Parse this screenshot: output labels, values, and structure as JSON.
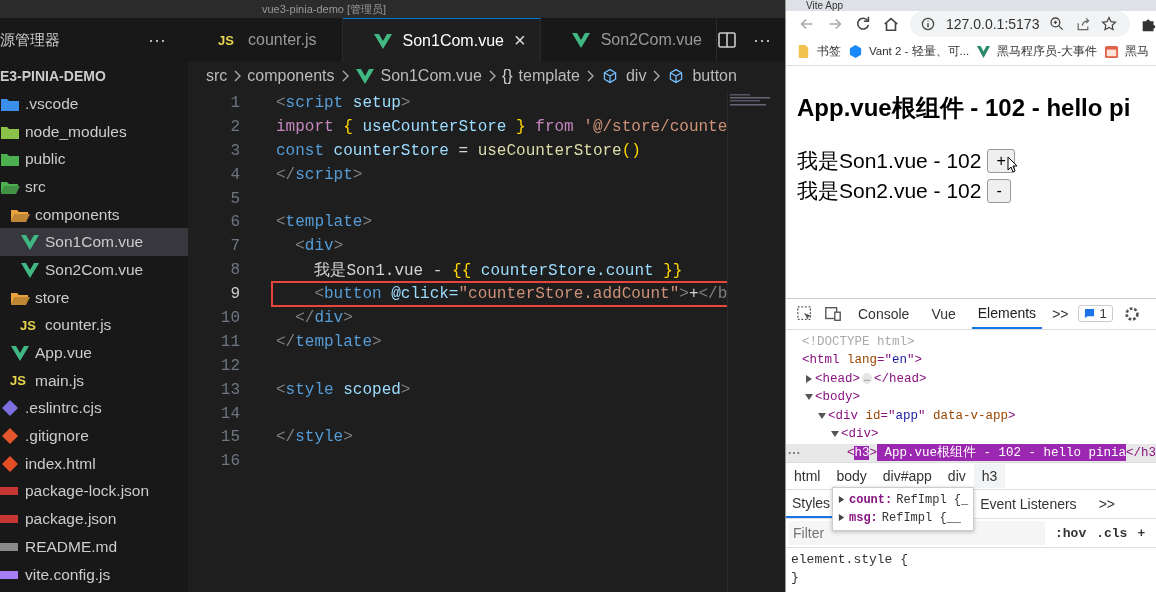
{
  "vscode": {
    "title": "vue3-pinia-demo [管理员]",
    "explorer": {
      "header": "源管理器",
      "more": "···",
      "root": "E3-PINIA-DEMO",
      "items": [
        {
          "name": ".vscode",
          "kind": "vscode-folder",
          "expanded": false,
          "selected": false
        },
        {
          "name": "node_modules",
          "kind": "node-folder",
          "expanded": false,
          "selected": false
        },
        {
          "name": "public",
          "kind": "public-folder",
          "expanded": false,
          "selected": false
        },
        {
          "name": "src",
          "kind": "src-folder",
          "expanded": true,
          "selected": false,
          "children": [
            {
              "name": "components",
              "kind": "folder",
              "expanded": true,
              "selected": false,
              "children": [
                {
                  "name": "Son1Com.vue",
                  "kind": "vue",
                  "selected": true
                },
                {
                  "name": "Son2Com.vue",
                  "kind": "vue",
                  "selected": false
                }
              ]
            },
            {
              "name": "store",
              "kind": "folder",
              "expanded": true,
              "selected": false,
              "children": [
                {
                  "name": "counter.js",
                  "kind": "js",
                  "badge": "JS",
                  "selected": false
                }
              ]
            },
            {
              "name": "App.vue",
              "kind": "vue",
              "selected": false
            },
            {
              "name": "main.js",
              "kind": "js",
              "badge": "JS",
              "selected": false
            }
          ]
        },
        {
          "name": ".eslintrc.cjs",
          "kind": "eslint",
          "selected": false
        },
        {
          "name": ".gitignore",
          "kind": "git",
          "selected": false
        },
        {
          "name": "index.html",
          "kind": "html",
          "selected": false
        },
        {
          "name": "package-lock.json",
          "kind": "npm",
          "selected": false
        },
        {
          "name": "package.json",
          "kind": "npm",
          "selected": false
        },
        {
          "name": "README.md",
          "kind": "md",
          "selected": false
        },
        {
          "name": "vite.config.js",
          "kind": "vite",
          "selected": false
        }
      ]
    },
    "tabs": [
      {
        "label": "counter.js",
        "kind": "js",
        "badge": "JS",
        "selected": false
      },
      {
        "label": "Son1Com.vue",
        "kind": "vue",
        "selected": true,
        "close": "×"
      },
      {
        "label": "Son2Com.vue",
        "kind": "vue",
        "selected": false
      }
    ],
    "tab_more": "···",
    "breadcrumb": [
      {
        "label": "src",
        "kind": "text"
      },
      {
        "label": "components",
        "kind": "text"
      },
      {
        "label": "Son1Com.vue",
        "kind": "vue"
      },
      {
        "label": "template",
        "kind": "braces",
        "badge": "{}"
      },
      {
        "label": "div",
        "kind": "cube"
      },
      {
        "label": "button",
        "kind": "cube"
      }
    ],
    "code": [
      {
        "number": "1",
        "current": false,
        "tokens": [
          {
            "text": "<",
            "kind": "punct"
          },
          {
            "text": "script",
            "kind": "tag"
          },
          {
            "text": " setup",
            "kind": "attr"
          },
          {
            "text": ">",
            "kind": "punct"
          }
        ]
      },
      {
        "number": "2",
        "current": false,
        "tokens": [
          {
            "text": "import ",
            "kind": "keyword"
          },
          {
            "text": "{",
            "kind": "brace"
          },
          {
            "text": " useCounterStore ",
            "kind": "var"
          },
          {
            "text": "}",
            "kind": "brace"
          },
          {
            "text": " from ",
            "kind": "keyword"
          },
          {
            "text": "'@/store/counte",
            "kind": "string"
          }
        ]
      },
      {
        "number": "3",
        "current": false,
        "tokens": [
          {
            "text": "const",
            "kind": "tag"
          },
          {
            "text": " counterStore",
            "kind": "var"
          },
          {
            "text": " = ",
            "kind": "plain"
          },
          {
            "text": "useCounterStore",
            "kind": "fn"
          },
          {
            "text": "()",
            "kind": "brace"
          }
        ]
      },
      {
        "number": "4",
        "current": false,
        "tokens": [
          {
            "text": "</",
            "kind": "punct"
          },
          {
            "text": "script",
            "kind": "tag"
          },
          {
            "text": ">",
            "kind": "punct"
          }
        ]
      },
      {
        "number": "5",
        "current": false
      },
      {
        "number": "6",
        "current": false,
        "tokens": [
          {
            "text": "<",
            "kind": "punct"
          },
          {
            "text": "template",
            "kind": "tag"
          },
          {
            "text": ">",
            "kind": "punct"
          }
        ]
      },
      {
        "number": "7",
        "current": false,
        "tokens": [
          {
            "text": "  <",
            "kind": "punct"
          },
          {
            "text": "div",
            "kind": "tag"
          },
          {
            "text": ">",
            "kind": "punct"
          }
        ]
      },
      {
        "number": "8",
        "current": false,
        "tokens": [
          {
            "text": "    我是Son1.vue - ",
            "kind": "plain"
          },
          {
            "text": "{{",
            "kind": "brace"
          },
          {
            "text": " counterStore.count ",
            "kind": "var"
          },
          {
            "text": "}}",
            "kind": "brace"
          }
        ]
      },
      {
        "number": "9",
        "current": true,
        "boxed": true,
        "tokens": [
          {
            "text": "    <",
            "kind": "punct"
          },
          {
            "text": "button",
            "kind": "tag"
          },
          {
            "text": " @click=",
            "kind": "attr"
          },
          {
            "text": "\"counterStore.addCount\"",
            "kind": "string"
          },
          {
            "text": ">",
            "kind": "punct"
          },
          {
            "text": "+",
            "kind": "plain"
          },
          {
            "text": "</b",
            "kind": "punct"
          }
        ]
      },
      {
        "number": "10",
        "current": false,
        "tokens": [
          {
            "text": "  </",
            "kind": "punct"
          },
          {
            "text": "div",
            "kind": "tag"
          },
          {
            "text": ">",
            "kind": "punct"
          }
        ]
      },
      {
        "number": "11",
        "current": false,
        "tokens": [
          {
            "text": "</",
            "kind": "punct"
          },
          {
            "text": "template",
            "kind": "tag"
          },
          {
            "text": ">",
            "kind": "punct"
          }
        ]
      },
      {
        "number": "12",
        "current": false
      },
      {
        "number": "13",
        "current": false,
        "tokens": [
          {
            "text": "<",
            "kind": "punct"
          },
          {
            "text": "style",
            "kind": "tag"
          },
          {
            "text": " scoped",
            "kind": "attr"
          },
          {
            "text": ">",
            "kind": "punct"
          }
        ]
      },
      {
        "number": "14",
        "current": false
      },
      {
        "number": "15",
        "current": false,
        "tokens": [
          {
            "text": "</",
            "kind": "punct"
          },
          {
            "text": "style",
            "kind": "tag"
          },
          {
            "text": ">",
            "kind": "punct"
          }
        ]
      },
      {
        "number": "16",
        "current": false
      }
    ]
  },
  "browser": {
    "tab_title": "Vite App",
    "url": "127.0.0.1:5173",
    "bookmarks": [
      {
        "label": "书签",
        "kind": "folder"
      },
      {
        "label": "Vant 2 - 轻量、可...",
        "kind": "vant"
      },
      {
        "label": "黑马程序员-大事件",
        "kind": "v"
      },
      {
        "label": "黑马",
        "kind": "calendar"
      }
    ],
    "page": {
      "heading": "App.vue根组件 - 102 - hello pi",
      "rows": [
        {
          "text": "我是Son1.vue - 102",
          "button": "+"
        },
        {
          "text": "我是Son2.vue - 102",
          "button": "-"
        }
      ]
    },
    "devtools": {
      "tabs": [
        {
          "label": "Console",
          "selected": false
        },
        {
          "label": "Vue",
          "selected": false
        },
        {
          "label": "Elements",
          "selected": true
        }
      ],
      "more": ">>",
      "issues": "1",
      "dom": [
        {
          "tokens": [
            {
              "text": "<!DOCTYPE html>",
              "kind": "doctype"
            }
          ],
          "selected": false
        },
        {
          "tokens": [
            {
              "text": "<html",
              "kind": "tag"
            },
            {
              "text": " lang",
              "kind": "attr"
            },
            {
              "text": "=\"",
              "kind": "tag"
            },
            {
              "text": "en",
              "kind": "value"
            },
            {
              "text": "\">",
              "kind": "tag"
            }
          ],
          "selected": false,
          "children": [
            {
              "tokens": [
                {
                  "text": "<head>",
                  "kind": "tag"
                },
                {
                  "text": "…",
                  "kind": "pill"
                },
                {
                  "text": "</head>",
                  "kind": "tag"
                }
              ],
              "expanded": false,
              "selected": false
            },
            {
              "tokens": [
                {
                  "text": "<body>",
                  "kind": "tag"
                }
              ],
              "expanded": true,
              "selected": false,
              "children": [
                {
                  "tokens": [
                    {
                      "text": "<div",
                      "kind": "tag"
                    },
                    {
                      "text": " id",
                      "kind": "attr"
                    },
                    {
                      "text": "=\"",
                      "kind": "tag"
                    },
                    {
                      "text": "app",
                      "kind": "value"
                    },
                    {
                      "text": "\"",
                      "kind": "tag"
                    },
                    {
                      "text": " data-v-app",
                      "kind": "attr"
                    },
                    {
                      "text": ">",
                      "kind": "tag"
                    }
                  ],
                  "expanded": true,
                  "selected": false,
                  "children": [
                    {
                      "tokens": [
                        {
                          "text": "<div>",
                          "kind": "tag"
                        }
                      ],
                      "expanded": true,
                      "selected": false,
                      "children": [
                        {
                          "tokens": [
                            {
                              "text": "<",
                              "kind": "tag"
                            },
                            {
                              "text": "h3",
                              "kind": "highlight"
                            },
                            {
                              "text": ">",
                              "kind": "tag"
                            },
                            {
                              "text": " App.vue根组件 - 102 - hello pinia",
                              "kind": "highlight"
                            },
                            {
                              "text": "</h3",
                              "kind": "tag"
                            }
                          ],
                          "selected": true
                        }
                      ]
                    }
                  ]
                }
              ]
            }
          ]
        }
      ],
      "crumbs": [
        {
          "label": "html",
          "selected": false
        },
        {
          "label": "body",
          "selected": false
        },
        {
          "label": "div#app",
          "selected": false
        },
        {
          "label": "div",
          "selected": false
        },
        {
          "label": "h3",
          "selected": true
        }
      ],
      "tooltip": [
        {
          "key": "count:",
          "value": "RefImpl {_"
        },
        {
          "key": "msg:",
          "value": "RefImpl {__"
        }
      ],
      "pane_tabs": [
        {
          "label": "Styles",
          "selected": true
        },
        {
          "label": "Event Listeners",
          "selected": false
        }
      ],
      "pane_more": ">>",
      "filter": {
        "placeholder": "Filter"
      },
      "filter_buttons": [
        ":hov",
        ".cls",
        "+"
      ],
      "rule": [
        "element.style {",
        "}"
      ]
    }
  }
}
